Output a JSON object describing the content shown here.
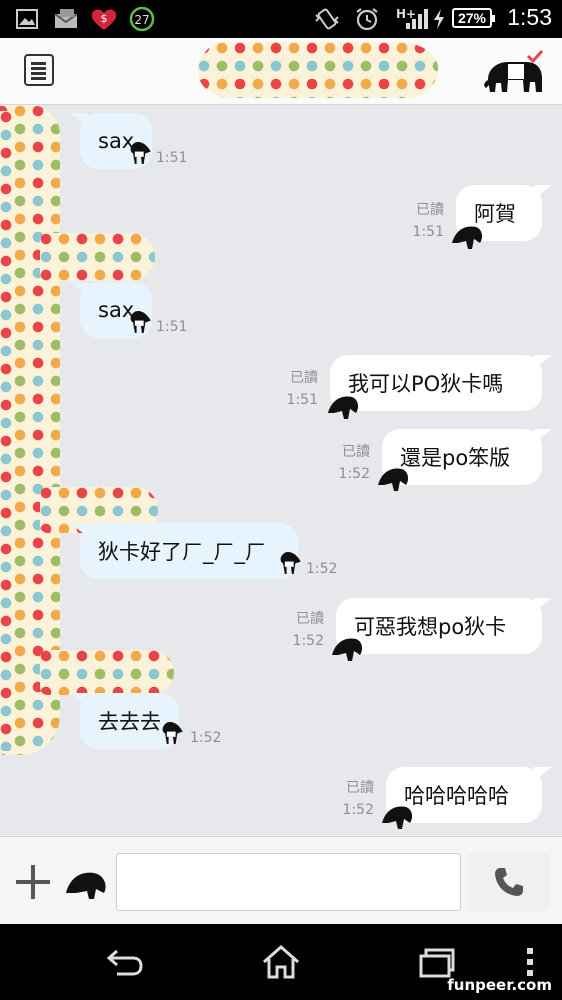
{
  "status_bar": {
    "notification_badge": "27",
    "network": "H+",
    "battery": "27%",
    "time": "1:53"
  },
  "messages": [
    {
      "dir": "in",
      "text": "sax",
      "time": "1:51"
    },
    {
      "dir": "out",
      "text": "阿賀",
      "read": "已讀",
      "time": "1:51"
    },
    {
      "dir": "in",
      "text": "sax",
      "time": "1:51"
    },
    {
      "dir": "out",
      "text": "我可以PO狄卡嗎",
      "read": "已讀",
      "time": "1:51"
    },
    {
      "dir": "out",
      "text": "還是po笨版",
      "read": "已讀",
      "time": "1:52"
    },
    {
      "dir": "in",
      "text": "狄卡好了ㄏ_ㄏ_ㄏ",
      "time": "1:52"
    },
    {
      "dir": "out",
      "text": "可惡我想po狄卡",
      "read": "已讀",
      "time": "1:52"
    },
    {
      "dir": "in",
      "text": "去去去",
      "time": "1:52"
    },
    {
      "dir": "out",
      "text": "哈哈哈哈哈",
      "read": "已讀",
      "time": "1:52"
    }
  ],
  "input": {
    "value": "",
    "placeholder": ""
  },
  "watermark": "funpeer.com",
  "colors": {
    "chat_bg": "#e7e8ec",
    "incoming_bubble": "#e8f4fd",
    "outgoing_bubble": "#ffffff",
    "dot_red": "#e94549",
    "dot_orange": "#f1a94a",
    "dot_blue": "#8cc6d0",
    "dot_green": "#9fbd64"
  }
}
